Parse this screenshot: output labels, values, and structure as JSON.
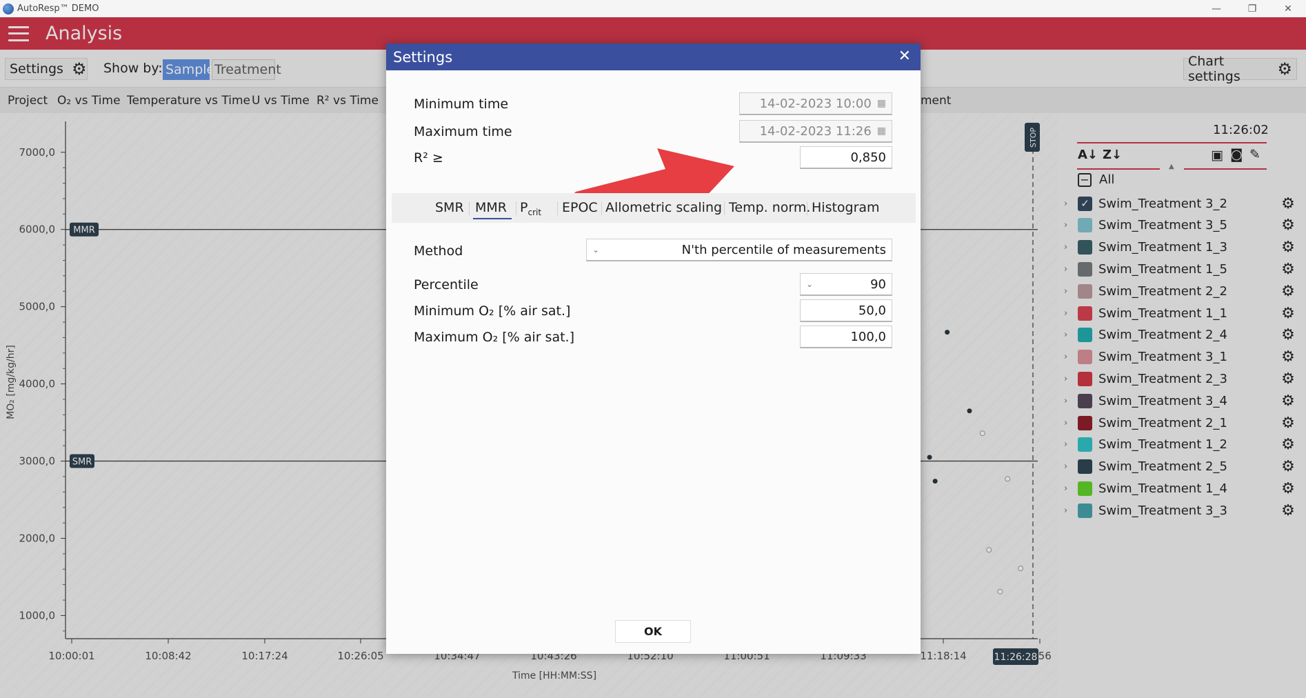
{
  "window": {
    "title": "AutoResp™ DEMO",
    "minimize": "—",
    "maximize": "❐",
    "close": "✕"
  },
  "header": {
    "title": "Analysis"
  },
  "toolbar": {
    "settings_label": "Settings",
    "show_by_label": "Show by:",
    "show_by_options": [
      "Sample",
      "Treatment"
    ],
    "show_by_selected": "Sample",
    "chart_settings_label": "Chart settings"
  },
  "tabs": [
    "Project",
    "O₂ vs Time",
    "Temperature vs Time",
    "U vs Time",
    "R² vs Time",
    "ment"
  ],
  "chart": {
    "y_title": "MO₂ [mg/kg/hr]",
    "x_title": "Time [HH:MM:SS]",
    "y_ticks": [
      "7000,0",
      "6000,0",
      "5000,0",
      "4000,0",
      "3000,0",
      "2000,0",
      "1000,0"
    ],
    "x_ticks": [
      "10:00:01",
      "10:08:42",
      "10:17:24",
      "10:26:05",
      "10:34:47",
      "10:43:26",
      "10:52:10",
      "11:00:51",
      "11:09:33",
      "11:18:14",
      "6:56"
    ],
    "mmr_label": "MMR",
    "smr_label": "SMR",
    "stop_label": "STOP",
    "cursor_time": "11:26:28"
  },
  "chart_data": {
    "type": "scatter",
    "ylabel": "MO₂ [mg/kg/hr]",
    "xlabel": "Time [HH:MM:SS]",
    "ylim": [
      700,
      7400
    ],
    "mmr_value": 6000,
    "smr_value": 3000,
    "filled_points": [
      {
        "x": "11:18:35",
        "y": 4670
      },
      {
        "x": "11:20:35",
        "y": 3650
      },
      {
        "x": "11:17:00",
        "y": 3050
      },
      {
        "x": "11:15:50",
        "y": 2620
      },
      {
        "x": "11:17:30",
        "y": 2740
      }
    ],
    "hollow_points": [
      {
        "x": "11:21:45",
        "y": 3360
      },
      {
        "x": "11:24:00",
        "y": 2770
      },
      {
        "x": "11:22:20",
        "y": 1850
      },
      {
        "x": "11:25:10",
        "y": 1610
      },
      {
        "x": "11:23:20",
        "y": 1310
      }
    ]
  },
  "right_panel": {
    "clock": "11:26:02",
    "all_label": "All",
    "samples": [
      {
        "name": "Swim_Treatment 3_2",
        "color": "#2a4258",
        "checked": true
      },
      {
        "name": "Swim_Treatment 3_5",
        "color": "#7cc3cf",
        "checked": false
      },
      {
        "name": "Swim_Treatment 1_3",
        "color": "#2f5860",
        "checked": false
      },
      {
        "name": "Swim_Treatment 1_5",
        "color": "#6f7478",
        "checked": false
      },
      {
        "name": "Swim_Treatment 2_2",
        "color": "#b89599",
        "checked": false
      },
      {
        "name": "Swim_Treatment 1_1",
        "color": "#d73a47",
        "checked": false
      },
      {
        "name": "Swim_Treatment 2_4",
        "color": "#18a9ad",
        "checked": false
      },
      {
        "name": "Swim_Treatment 3_1",
        "color": "#d98d97",
        "checked": false
      },
      {
        "name": "Swim_Treatment 2_3",
        "color": "#cf2e3b",
        "checked": false
      },
      {
        "name": "Swim_Treatment 3_4",
        "color": "#4f4052",
        "checked": false
      },
      {
        "name": "Swim_Treatment 2_1",
        "color": "#8a1420",
        "checked": false
      },
      {
        "name": "Swim_Treatment 1_2",
        "color": "#27c1c5",
        "checked": false
      },
      {
        "name": "Swim_Treatment 2_5",
        "color": "#243e4a",
        "checked": false
      },
      {
        "name": "Swim_Treatment 1_4",
        "color": "#59d11f",
        "checked": false
      },
      {
        "name": "Swim_Treatment 3_3",
        "color": "#3d9ea8",
        "checked": false
      }
    ]
  },
  "dialog": {
    "title": "Settings",
    "min_time_label": "Minimum time",
    "min_time_value": "14-02-2023 10:00",
    "max_time_label": "Maximum time",
    "max_time_value": "14-02-2023 11:26",
    "r2_label": "R² ≥",
    "r2_value": "0,850",
    "tabs": [
      "SMR",
      "MMR",
      "Pcrit",
      "EPOC",
      "Allometric scaling",
      "Temp. norm.",
      "Histogram"
    ],
    "active_tab": "MMR",
    "method_label": "Method",
    "method_value": "N'th percentile of measurements",
    "percentile_label": "Percentile",
    "percentile_value": "90",
    "min_o2_label": "Minimum O₂ [% air sat.]",
    "min_o2_value": "50,0",
    "max_o2_label": "Maximum O₂ [% air sat.]",
    "max_o2_value": "100,0",
    "ok_label": "OK"
  },
  "colors": {
    "header": "#d12e42",
    "dialog_title": "#3a4f9e",
    "accent": "#5b8de0",
    "arrow": "#e63e42"
  }
}
